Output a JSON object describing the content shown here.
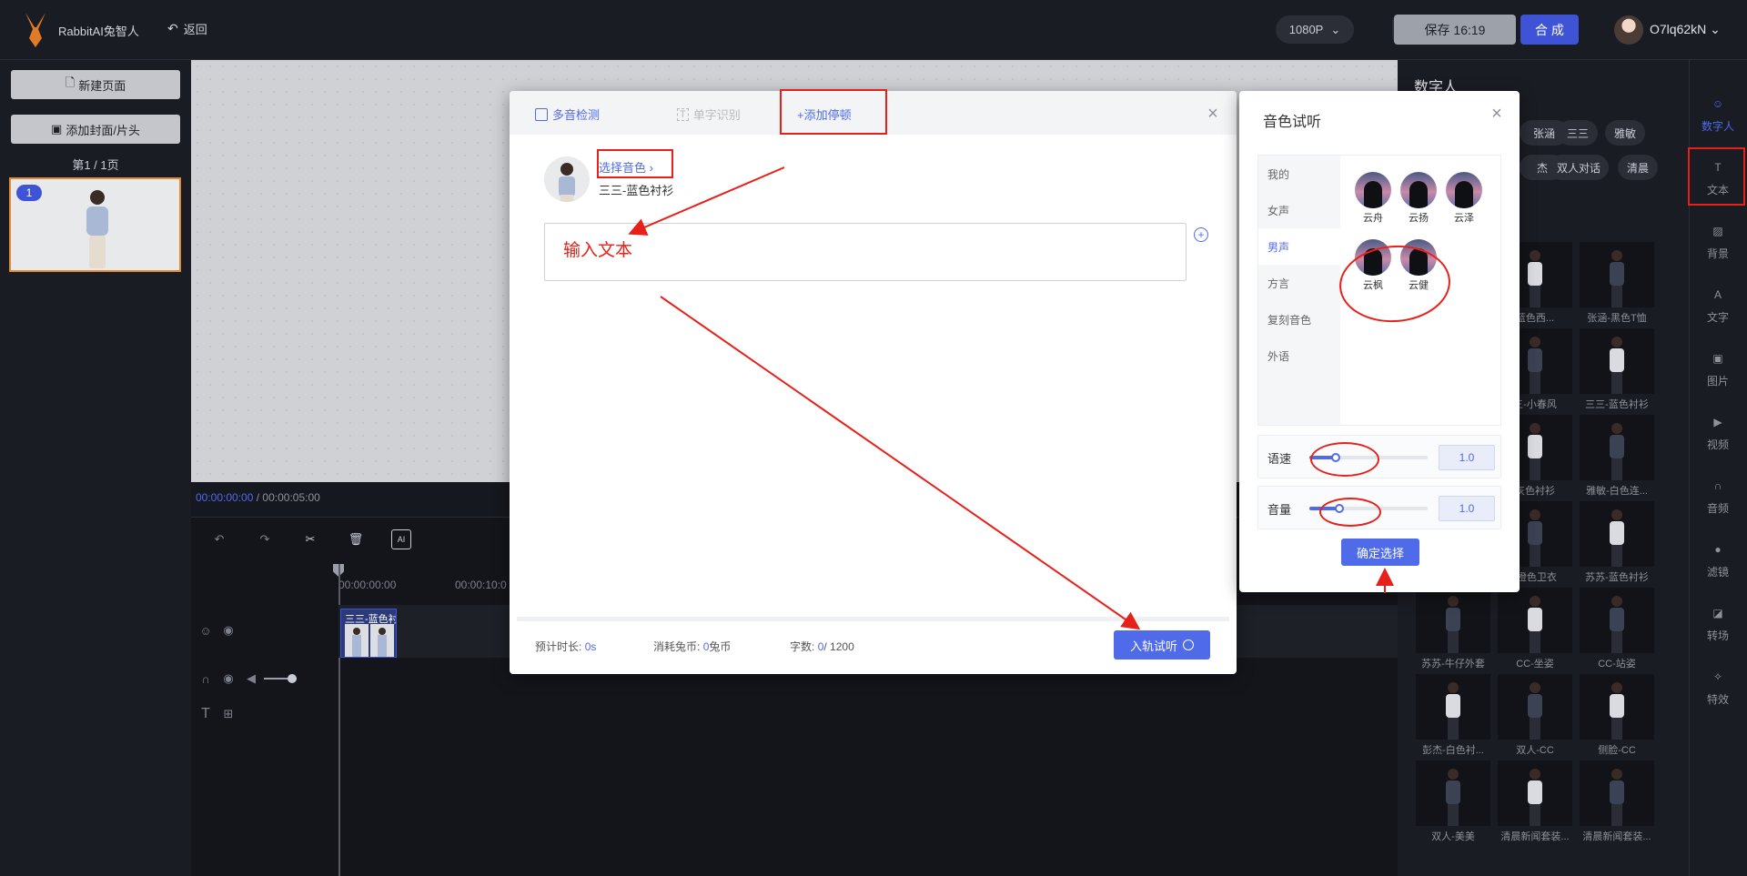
{
  "app": {
    "name": "RabbitAI兔智人",
    "back_label": "返回"
  },
  "header": {
    "resolution": "1080P",
    "save_label": "保存 16:19",
    "compose_label": "合 成",
    "username": "O7lq62kN"
  },
  "left": {
    "new_page": "新建页面",
    "add_cover": "添加封面/片头",
    "page_indicator": "第1 / 1页",
    "thumb_number": "1"
  },
  "timeline": {
    "current": "00:00:00:00",
    "separator": " / ",
    "total": "00:00:05:00",
    "tick1": "00:00:00:00",
    "tick2": "00:00:10:0",
    "clip_label": "三三-蓝色衬"
  },
  "right": {
    "title": "数字人",
    "chips": [
      "张涵",
      "三三",
      "雅敏",
      "杰",
      "双人对话",
      "清晨"
    ],
    "cells": [
      "",
      "蓝色西...",
      "张涵-黑色T恤",
      "",
      "三-小春风",
      "三三-蓝色衬衫",
      "",
      "灰色衬衫",
      "雅敏-白色连...",
      "",
      "-橙色卫衣",
      "苏苏-蓝色衬衫",
      "苏苏-牛仔外套",
      "CC-坐姿",
      "CC-站姿",
      "彭杰-白色衬...",
      "双人-CC",
      "侧脸-CC",
      "双人-美美",
      "清晨新闻套装...",
      "清晨新闻套装..."
    ]
  },
  "rail": [
    {
      "icon": "digital-human-icon",
      "label": "数字人"
    },
    {
      "icon": "text-icon",
      "label": "文本"
    },
    {
      "icon": "background-icon",
      "label": "背景"
    },
    {
      "icon": "letter-icon",
      "label": "文字"
    },
    {
      "icon": "image-icon",
      "label": "图片"
    },
    {
      "icon": "video-icon",
      "label": "视频"
    },
    {
      "icon": "audio-icon",
      "label": "音频"
    },
    {
      "icon": "filter-icon",
      "label": "滤镜"
    },
    {
      "icon": "transition-icon",
      "label": "转场"
    },
    {
      "icon": "effects-icon",
      "label": "特效"
    }
  ],
  "dialog": {
    "tab_polyphone": "多音检测",
    "tab_single": "单字识别",
    "tab_pause": "+添加停顿",
    "select_voice": "选择音色 ›",
    "voice_name": "三三-蓝色衬衫",
    "input_text": "输入文本",
    "est_label": "预计时长:",
    "est_value": "0",
    "est_unit": "s",
    "cost_label": "消耗兔币:",
    "cost_value": "0",
    "cost_unit": "兔币",
    "count_label": "字数:",
    "count_value": "0",
    "count_total": "/ 1200",
    "try_label": "入轨试听"
  },
  "voice_panel": {
    "title": "音色试听",
    "categories": [
      "我的",
      "女声",
      "男声",
      "方言",
      "复刻音色",
      "外语"
    ],
    "selected": "男声",
    "voices": [
      "云舟",
      "云扬",
      "云泽",
      "云枫",
      "云健"
    ],
    "speed_label": "语速",
    "speed_value": "1.0",
    "speed_level": 0.22,
    "volume_label": "音量",
    "volume_value": "1.0",
    "volume_level": 0.25,
    "confirm_label": "确定选择"
  },
  "colors": {
    "accent": "#4f6bea",
    "annotation": "#e8201a"
  }
}
